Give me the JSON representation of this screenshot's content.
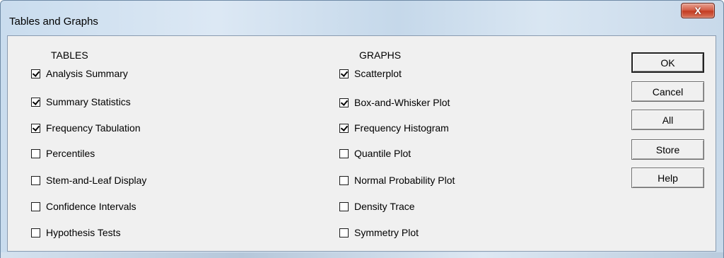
{
  "window": {
    "title": "Tables and Graphs",
    "close_glyph": "X",
    "close_icon": "close-icon"
  },
  "tables": {
    "header": "TABLES",
    "items": [
      {
        "label": "Analysis Summary",
        "checked": true
      },
      {
        "label": "Summary Statistics",
        "checked": true
      },
      {
        "label": "Frequency Tabulation",
        "checked": true
      },
      {
        "label": "Percentiles",
        "checked": false
      },
      {
        "label": "Stem-and-Leaf Display",
        "checked": false
      },
      {
        "label": "Confidence Intervals",
        "checked": false
      },
      {
        "label": "Hypothesis Tests",
        "checked": false
      }
    ]
  },
  "graphs": {
    "header": "GRAPHS",
    "items": [
      {
        "label": "Scatterplot",
        "checked": true
      },
      {
        "label": "Box-and-Whisker Plot",
        "checked": true
      },
      {
        "label": "Frequency Histogram",
        "checked": true
      },
      {
        "label": "Quantile Plot",
        "checked": false
      },
      {
        "label": "Normal Probability Plot",
        "checked": false
      },
      {
        "label": "Density Trace",
        "checked": false
      },
      {
        "label": "Symmetry Plot",
        "checked": false
      }
    ]
  },
  "buttons": {
    "ok": "OK",
    "cancel": "Cancel",
    "all": "All",
    "store": "Store",
    "help": "Help"
  },
  "colors": {
    "title_gradient": "#c9dcee",
    "close_button": "#c43c22",
    "dialog_face": "#f0f0f0"
  }
}
